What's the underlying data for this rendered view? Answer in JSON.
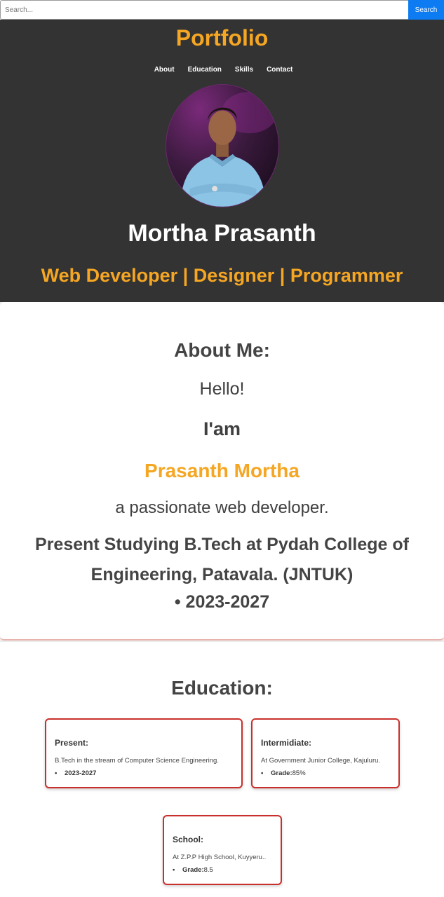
{
  "search": {
    "placeholder": "Search...",
    "button_label": "Search"
  },
  "header": {
    "logo": "Portfolio",
    "nav": [
      "About",
      "Education",
      "Skills",
      "Contact"
    ],
    "name": "Mortha Prasanth",
    "roles": "Web Developer | Designer | Programmer"
  },
  "about": {
    "title": "About Me:",
    "hello": "Hello!",
    "iam": "I'am",
    "name": "Prasanth Mortha",
    "tagline": "a passionate web developer.",
    "study": "Present Studying B.Tech at Pydah College of Engineering, Patavala. (JNTUK)",
    "years": "• 2023-2027"
  },
  "education": {
    "title": "Education:",
    "cards": [
      {
        "title": "Present:",
        "desc": "B.Tech in the stream of Computer Science Engineering.",
        "item_label": "2023-2027",
        "item_value": ""
      },
      {
        "title": "Intermidiate:",
        "desc": "At Government Junior College, Kajuluru.",
        "item_label": "Grade:",
        "item_value": "85%"
      },
      {
        "title": "School:",
        "desc": "At Z.P.P High School, Kuyyeru..",
        "item_label": "Grade:",
        "item_value": "8.5"
      }
    ]
  },
  "colors": {
    "accent": "#f5a623",
    "header_bg": "#333333",
    "search_button": "#0d7cf2",
    "card_border": "#c9302c"
  }
}
